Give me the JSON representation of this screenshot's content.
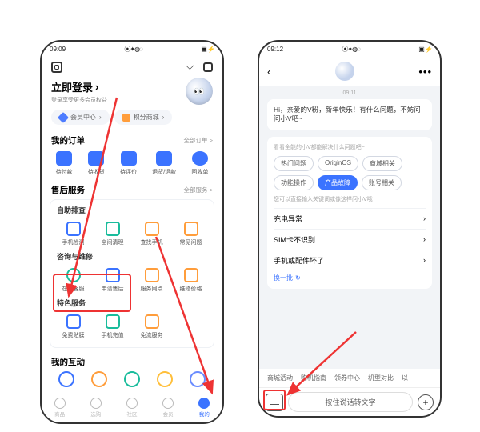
{
  "left": {
    "status_time": "09:09",
    "status_icons_l": "⦿✦◍◌",
    "status_icons_r": "▣ ⚡",
    "login_title": "立即登录",
    "login_sub": "登录享受更多会员权益",
    "pill_member": "会员中心",
    "pill_points": "积分商城",
    "orders_title": "我的订单",
    "orders_more": "全部订单 >",
    "orders": [
      "待付款",
      "待收货",
      "待评价",
      "退货/退款",
      "回收单"
    ],
    "aftersale_title": "售后服务",
    "aftersale_more": "全部服务 >",
    "self_check": "自助排查",
    "self_items": [
      "手机检测",
      "空间清理",
      "查找手机",
      "常见问题"
    ],
    "consult": "咨询与维修",
    "consult_items": [
      "在线客服",
      "申请售后",
      "服务网点",
      "维修价格"
    ],
    "special": "特色服务",
    "special_items": [
      "免费贴膜",
      "手机充值",
      "免流服务"
    ],
    "interact": "我的互动",
    "nav": [
      "商品",
      "选购",
      "社区",
      "会员",
      "我的"
    ]
  },
  "right": {
    "status_time": "09:12",
    "status_icons_l": "⦿✦◍◌",
    "status_icons_r": "▣ ⚡",
    "time_stamp": "09:11",
    "greeting": "Hi，亲爱的V粉，新年快乐！有什么问题，不妨问问小V吧~",
    "card_hint": "看看全能的小V都能解决什么问题吧~",
    "chips": [
      "热门问题",
      "OriginOS",
      "商城相关",
      "功能操作",
      "产品故障",
      "账号相关"
    ],
    "faq_hint": "您可以直接输入关键词或像这样问小V哦",
    "faqs": [
      "充电异常",
      "SIM卡不识别",
      "手机或配件坏了"
    ],
    "swap": "换一批",
    "quick": [
      "商城活动",
      "购机指南",
      "领券中心",
      "机型对比",
      "以"
    ],
    "voice_placeholder": "按住说话转文字"
  }
}
